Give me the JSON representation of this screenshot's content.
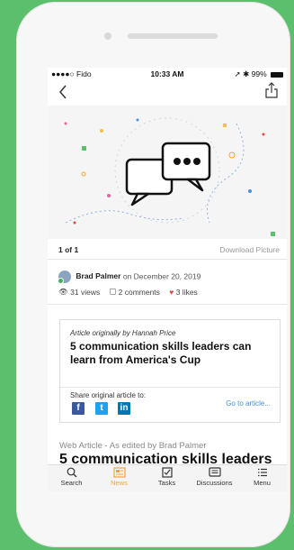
{
  "status_bar": {
    "carrier": "●●●●○ Fido",
    "time": "10:33 AM",
    "battery": "99%"
  },
  "picture_bar": {
    "count": "1 of 1",
    "download": "Download Picture"
  },
  "author": {
    "name": "Brad Palmer",
    "date": "on December 20, 2019"
  },
  "stats": {
    "views": "31 views",
    "comments": "2 comments",
    "likes": "3 likes"
  },
  "card": {
    "origin": "Article originally by Hannah Price",
    "title": "5 communication skills leaders can learn from America's Cup",
    "share_label": "Share original article to:",
    "go_to": "Go to article..."
  },
  "web_article": {
    "label": "Web Article - As edited by Brad Palmer",
    "title": "5 communication skills leaders"
  },
  "tabs": [
    {
      "label": "Search",
      "icon": "search-icon"
    },
    {
      "label": "News",
      "icon": "news-icon"
    },
    {
      "label": "Tasks",
      "icon": "tasks-icon"
    },
    {
      "label": "Discussions",
      "icon": "discussions-icon"
    },
    {
      "label": "Menu",
      "icon": "menu-icon"
    }
  ],
  "colors": {
    "background": "#5cbf6e",
    "accent": "#f2a33a",
    "link": "#4a90d9",
    "heart": "#e04a4a"
  }
}
